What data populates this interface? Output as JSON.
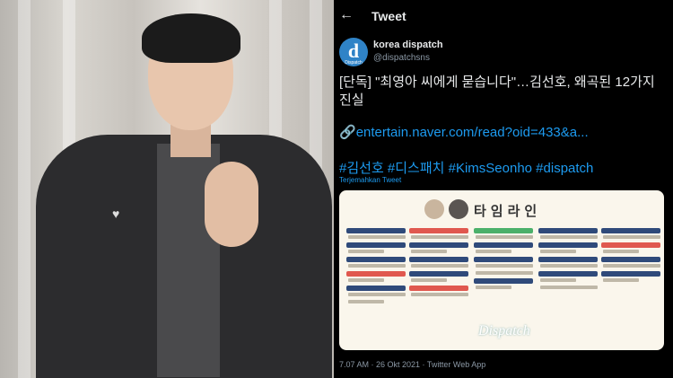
{
  "header": {
    "back_icon": "arrow-left-icon",
    "title": "Tweet"
  },
  "account": {
    "name": "korea dispatch",
    "handle": "@dispatchsns",
    "avatar_letter": "d",
    "avatar_caption": "Dispatch"
  },
  "tweet": {
    "text": "[단독] \"최영아 씨에게 묻습니다\"…김선호, 왜곡된 12가지 진실",
    "link": "entertain.naver.com/read?oid=433&a...",
    "hashtags": "#김선호 #디스패치 #KimsSeonho #dispatch",
    "translate": "Terjemahkan Tweet",
    "timestamp": "7.07 AM · 26 Okt 2021 · Twitter Web App"
  },
  "card": {
    "title": "타임라인",
    "watermark": "Dispatch"
  },
  "colors": {
    "link": "#1d9bf0",
    "background": "#000000",
    "text": "#e7e9ea"
  }
}
